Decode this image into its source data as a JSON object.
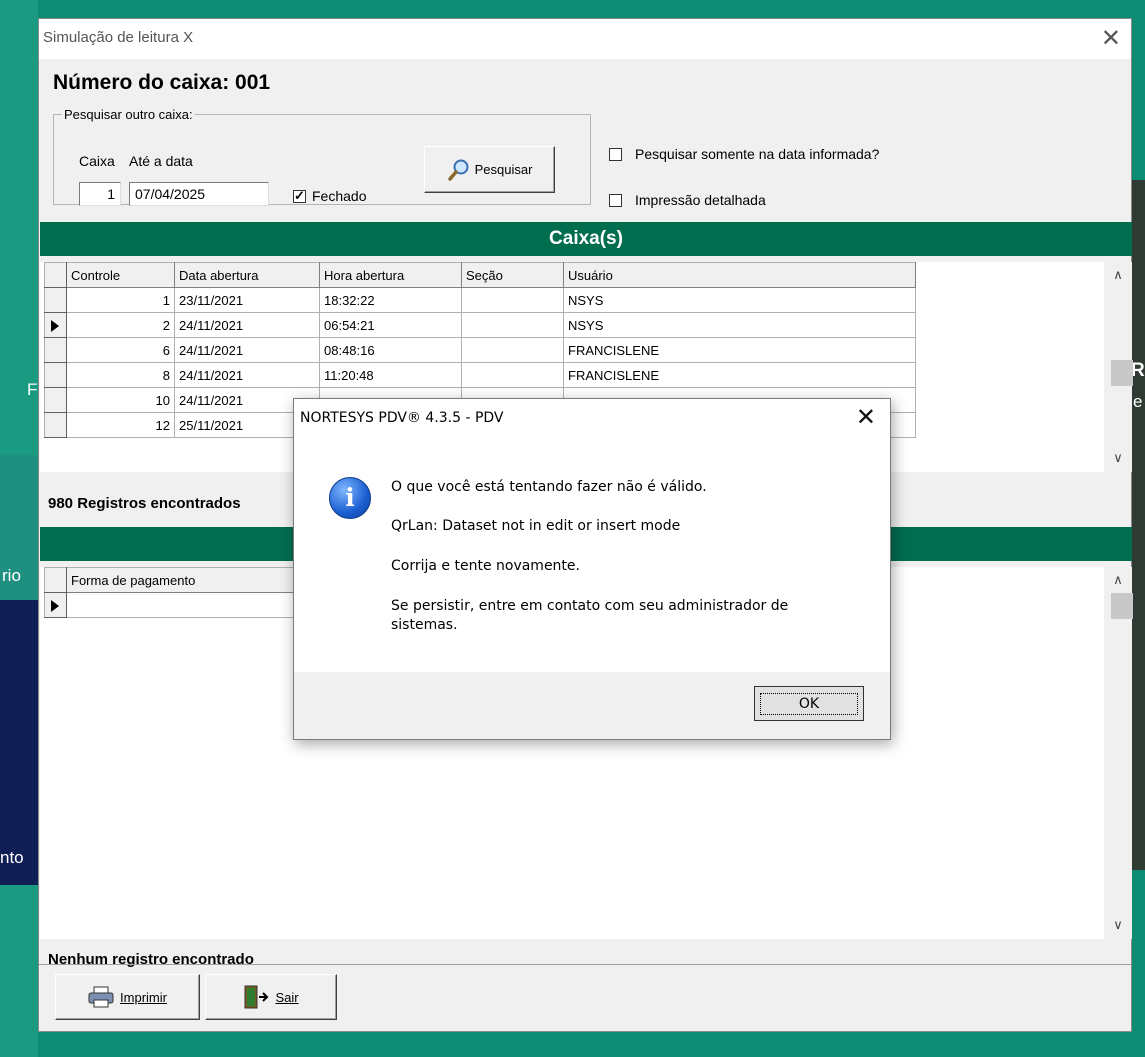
{
  "window": {
    "title": "Simulação de leitura X"
  },
  "header": {
    "numero_caixa": "Número do caixa: 001",
    "group_label": "Pesquisar outro caixa:",
    "caixa_label": "Caixa",
    "ate_data_label": "Até a data",
    "caixa_value": "1",
    "data_value": "07/04/2025",
    "fechado_label": "Fechado",
    "fechado_checked": true,
    "pesquisar_label": "Pesquisar",
    "somente_data_label": "Pesquisar somente na data informada?",
    "impressao_label": "Impressão detalhada"
  },
  "caixas": {
    "title": "Caixa(s)",
    "columns": [
      "Controle",
      "Data abertura",
      "Hora abertura",
      "Seção",
      "Usuário"
    ],
    "rows": [
      {
        "controle": "1",
        "data": "23/11/2021",
        "hora": "18:32:22",
        "secao": "",
        "usuario": "NSYS"
      },
      {
        "controle": "2",
        "data": "24/11/2021",
        "hora": "06:54:21",
        "secao": "",
        "usuario": "NSYS"
      },
      {
        "controle": "6",
        "data": "24/11/2021",
        "hora": "08:48:16",
        "secao": "",
        "usuario": "FRANCISLENE"
      },
      {
        "controle": "8",
        "data": "24/11/2021",
        "hora": "11:20:48",
        "secao": "",
        "usuario": "FRANCISLENE"
      },
      {
        "controle": "10",
        "data": "24/11/2021",
        "hora": "",
        "secao": "",
        "usuario": ""
      },
      {
        "controle": "12",
        "data": "25/11/2021",
        "hora": "",
        "secao": "",
        "usuario": ""
      }
    ],
    "status": "980 Registros encontrados"
  },
  "pagamentos": {
    "columns": [
      "Forma de pagamento"
    ],
    "status": "Nenhum registro encontrado"
  },
  "footer": {
    "imprimir_label": "Imprimir",
    "sair_label": "Sair"
  },
  "dialog": {
    "title": "NORTESYS PDV® 4.3.5 - PDV",
    "line1": "O que você está tentando fazer não é válido.",
    "line2": "QrLan: Dataset not in edit or insert mode",
    "line3": "Corrija e tente novamente.",
    "line4a": "Se persistir, entre em contato com seu administrador de",
    "line4b": "sistemas.",
    "ok_label": "OK"
  },
  "background": {
    "left_text_1": "F",
    "left_text_2": "rio",
    "left_text_3": "nto",
    "right_text_1": "R",
    "right_text_2": "e"
  },
  "colors": {
    "header_green": "#006d4f",
    "background_teal": "#0e8c73"
  }
}
